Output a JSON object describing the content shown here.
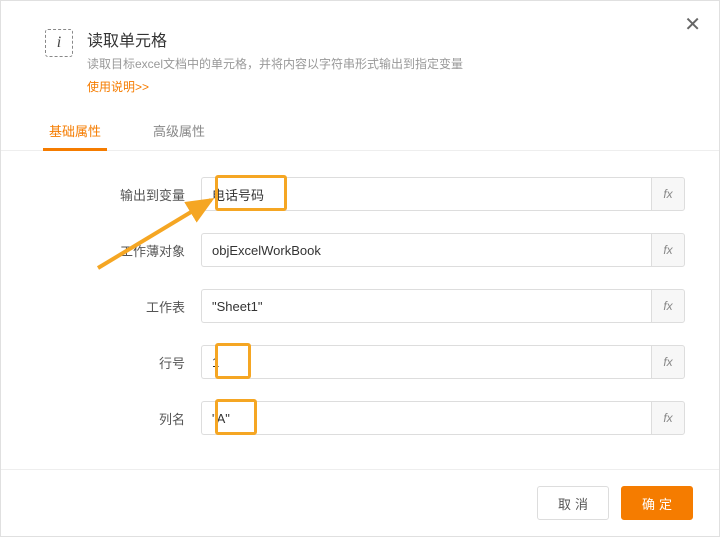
{
  "header": {
    "icon_letter": "i",
    "title": "读取单元格",
    "subtitle": "读取目标excel文档中的单元格，并将内容以字符串形式输出到指定变量",
    "usage_link": "使用说明>>"
  },
  "tabs": {
    "basic": "基础属性",
    "advanced": "高级属性"
  },
  "fields": {
    "output_var": {
      "label": "输出到变量",
      "value": "电话号码"
    },
    "workbook": {
      "label": "工作薄对象",
      "value": "objExcelWorkBook"
    },
    "worksheet": {
      "label": "工作表",
      "value": "\"Sheet1\""
    },
    "row_num": {
      "label": "行号",
      "value": "1"
    },
    "col_name": {
      "label": "列名",
      "value": "\"A\""
    }
  },
  "fx_label": "fx",
  "buttons": {
    "cancel": "取消",
    "ok": "确定"
  }
}
